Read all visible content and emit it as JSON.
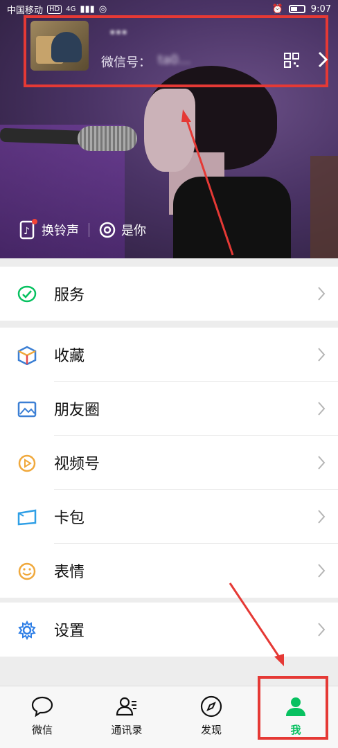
{
  "status_bar": {
    "carrier": "中国移动",
    "hd": "HD",
    "network": "4G",
    "time": "9:07"
  },
  "profile": {
    "nickname": "…",
    "wechat_id_label": "微信号：",
    "wechat_id_value": "ta0…",
    "qr_icon": "qr-code-icon",
    "chevron_icon": "chevron-right-icon"
  },
  "ringtone": {
    "change_label": "换铃声",
    "song_label": "是你"
  },
  "menu": {
    "service": {
      "label": "服务",
      "icon": "service-icon",
      "color": "#07c160"
    },
    "favorites": {
      "label": "收藏",
      "icon": "cube-icon"
    },
    "moments": {
      "label": "朋友圈",
      "icon": "photo-icon",
      "color": "#3b7fd4"
    },
    "channels": {
      "label": "视频号",
      "icon": "play-circle-icon",
      "color": "#f0a83b"
    },
    "cards": {
      "label": "卡包",
      "icon": "card-icon",
      "color": "#2f9fe6"
    },
    "stickers": {
      "label": "表情",
      "icon": "smile-icon",
      "color": "#f0a83b"
    },
    "settings": {
      "label": "设置",
      "icon": "gear-icon",
      "color": "#2f7fe6"
    }
  },
  "tabbar": {
    "chats": "微信",
    "contacts": "通讯录",
    "discover": "发现",
    "me": "我",
    "active_color": "#07c160"
  },
  "annotation_color": "#e53935"
}
